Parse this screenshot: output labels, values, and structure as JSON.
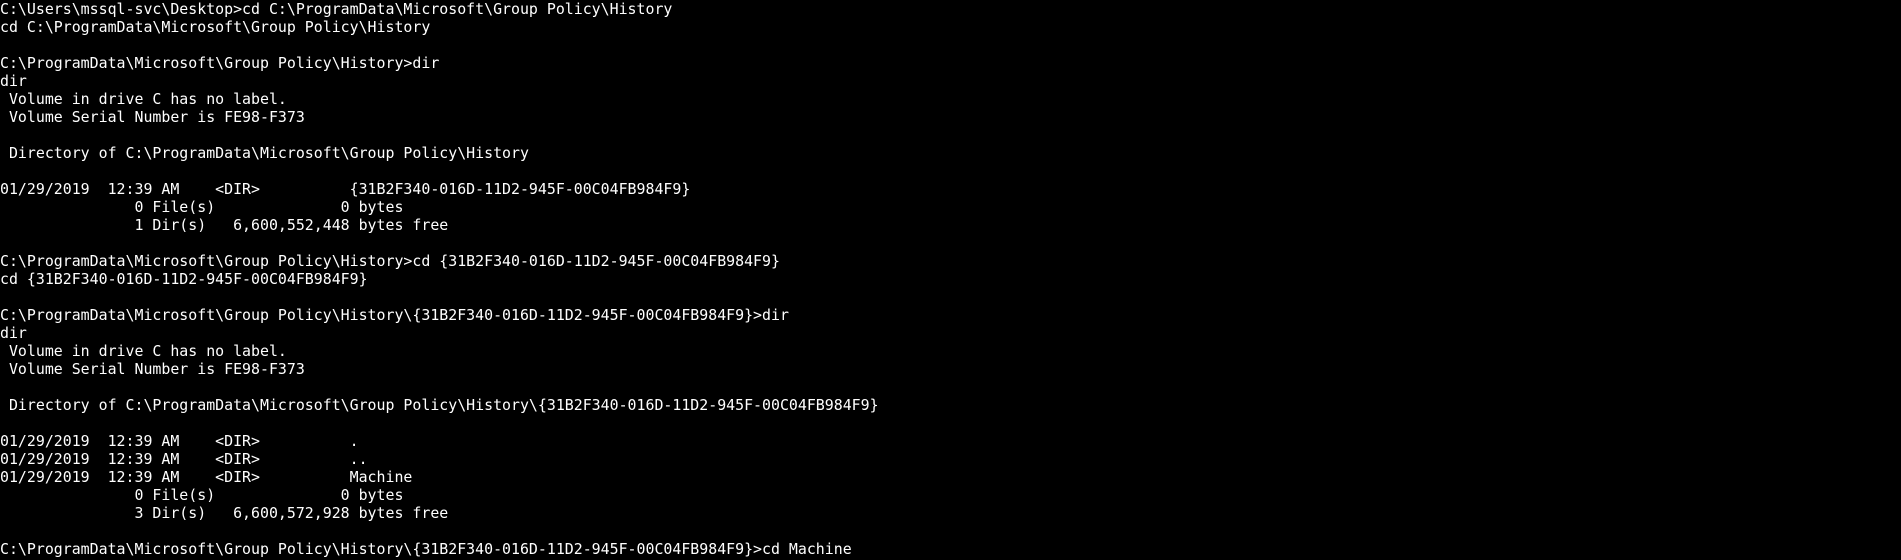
{
  "terminal": {
    "lines": [
      "C:\\Users\\mssql-svc\\Desktop>cd C:\\ProgramData\\Microsoft\\Group Policy\\History",
      "cd C:\\ProgramData\\Microsoft\\Group Policy\\History",
      "",
      "C:\\ProgramData\\Microsoft\\Group Policy\\History>dir",
      "dir",
      " Volume in drive C has no label.",
      " Volume Serial Number is FE98-F373",
      "",
      " Directory of C:\\ProgramData\\Microsoft\\Group Policy\\History",
      "",
      "01/29/2019  12:39 AM    <DIR>          {31B2F340-016D-11D2-945F-00C04FB984F9}",
      "               0 File(s)              0 bytes",
      "               1 Dir(s)   6,600,552,448 bytes free",
      "",
      "C:\\ProgramData\\Microsoft\\Group Policy\\History>cd {31B2F340-016D-11D2-945F-00C04FB984F9}",
      "cd {31B2F340-016D-11D2-945F-00C04FB984F9}",
      "",
      "C:\\ProgramData\\Microsoft\\Group Policy\\History\\{31B2F340-016D-11D2-945F-00C04FB984F9}>dir",
      "dir",
      " Volume in drive C has no label.",
      " Volume Serial Number is FE98-F373",
      "",
      " Directory of C:\\ProgramData\\Microsoft\\Group Policy\\History\\{31B2F340-016D-11D2-945F-00C04FB984F9}",
      "",
      "01/29/2019  12:39 AM    <DIR>          .",
      "01/29/2019  12:39 AM    <DIR>          ..",
      "01/29/2019  12:39 AM    <DIR>          Machine",
      "               0 File(s)              0 bytes",
      "               3 Dir(s)   6,600,572,928 bytes free",
      "",
      "C:\\ProgramData\\Microsoft\\Group Policy\\History\\{31B2F340-016D-11D2-945F-00C04FB984F9}>cd Machine"
    ]
  }
}
